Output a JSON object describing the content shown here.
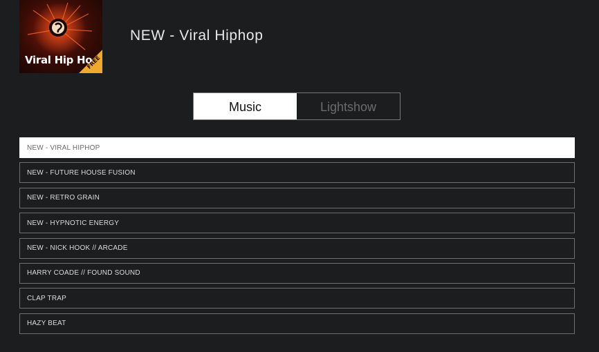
{
  "header": {
    "cover_art_text": "Viral Hip Ho",
    "cover_badge": "FREE",
    "now_title": "NEW - Viral Hiphop"
  },
  "tabs": [
    {
      "label": "Music",
      "active": true
    },
    {
      "label": "Lightshow",
      "active": false
    }
  ],
  "tracks": [
    {
      "label": "NEW - VIRAL HIPHOP",
      "selected": true
    },
    {
      "label": "NEW - FUTURE HOUSE FUSION",
      "selected": false
    },
    {
      "label": "NEW - RETRO GRAIN",
      "selected": false
    },
    {
      "label": "NEW - HYPNOTIC ENERGY",
      "selected": false
    },
    {
      "label": "NEW - NICK HOOK // ARCADE",
      "selected": false
    },
    {
      "label": "HARRY COADE // FOUND SOUND",
      "selected": false
    },
    {
      "label": "CLAP TRAP",
      "selected": false
    },
    {
      "label": "HAZY BEAT",
      "selected": false
    }
  ],
  "colors": {
    "background": "#1c1d1f",
    "selected_bg": "#ffffff",
    "border": "#6f6f6f",
    "badge": "#f0a830"
  }
}
